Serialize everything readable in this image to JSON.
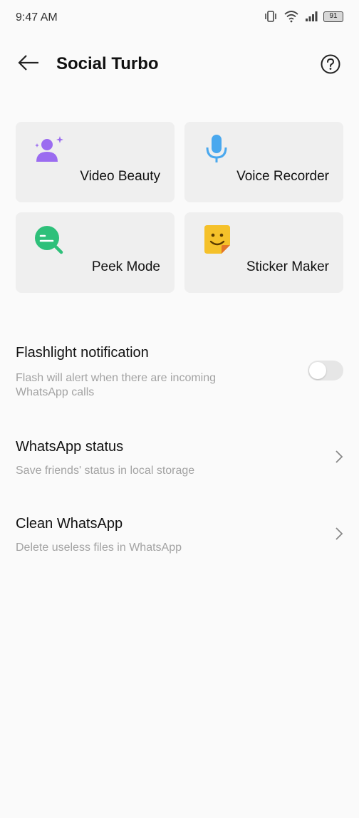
{
  "status_bar": {
    "time": "9:47 AM",
    "battery_level": "91",
    "icons": [
      "vibrate-icon",
      "wifi-icon",
      "signal-icon",
      "battery-icon"
    ]
  },
  "header": {
    "title": "Social Turbo",
    "back_icon": "arrow-left-icon",
    "help_icon": "help-circle-icon"
  },
  "tiles": [
    {
      "label": "Video Beauty",
      "icon": "person-sparkle-icon",
      "color": "#9b6cf0"
    },
    {
      "label": "Voice Recorder",
      "icon": "microphone-icon",
      "color": "#4aa8ee"
    },
    {
      "label": "Peek Mode",
      "icon": "magnifier-icon",
      "color": "#2ec07a"
    },
    {
      "label": "Sticker Maker",
      "icon": "smiley-sticker-icon",
      "color": "#f5c12a"
    }
  ],
  "settings": {
    "flashlight": {
      "title": "Flashlight notification",
      "subtitle": "Flash will alert when there are incoming WhatsApp calls",
      "enabled": false
    },
    "status": {
      "title": "WhatsApp status",
      "subtitle": "Save friends' status in local storage"
    },
    "clean": {
      "title": "Clean WhatsApp",
      "subtitle": "Delete useless files in WhatsApp"
    }
  }
}
